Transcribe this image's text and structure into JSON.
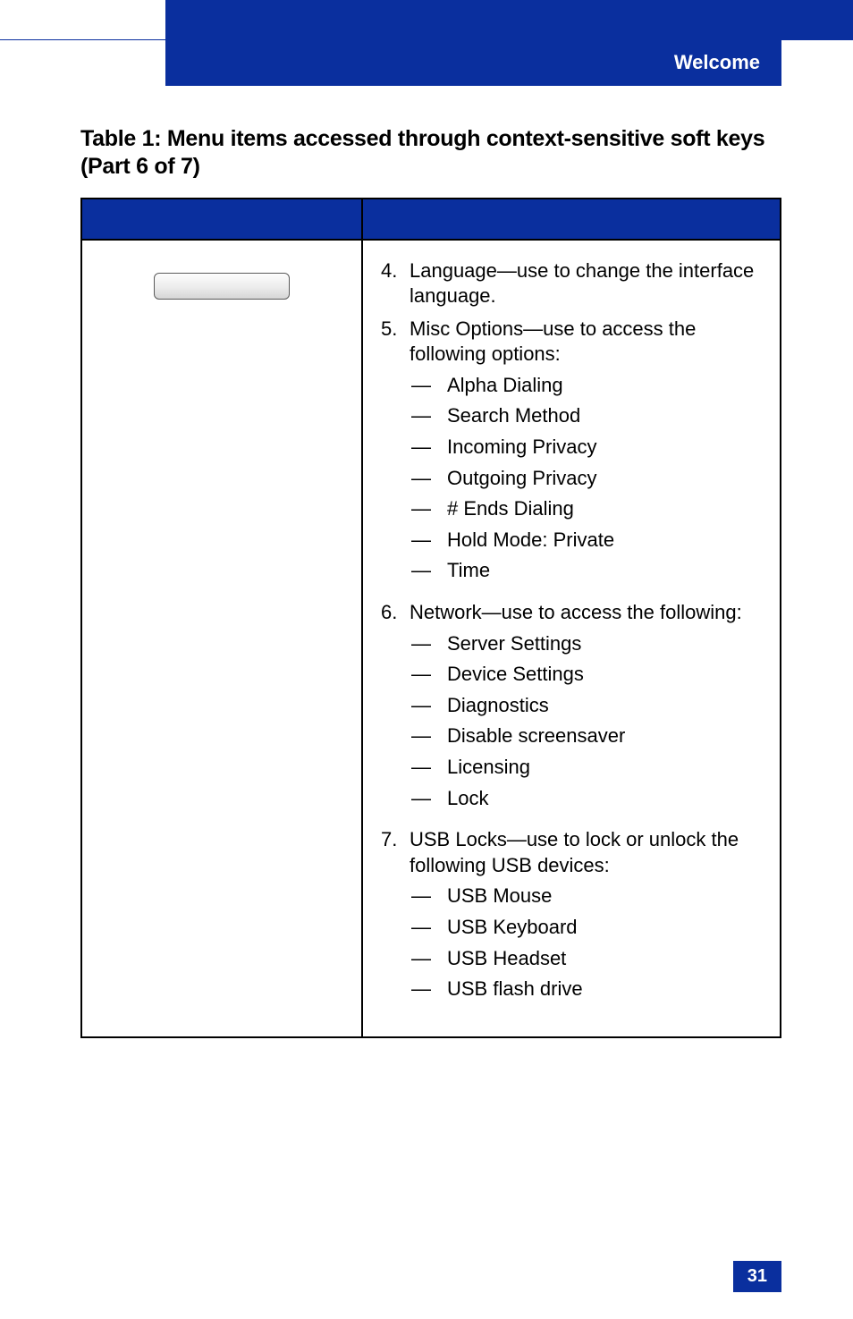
{
  "header": {
    "section_label": "Welcome"
  },
  "table": {
    "title": "Table 1: Menu items accessed through context-sensitive soft keys (Part 6 of 7)",
    "items": [
      {
        "num": "4.",
        "text": "Language—use to change the interface language."
      },
      {
        "num": "5.",
        "text": "Misc Options—use to access the following options:",
        "sub": [
          "Alpha Dialing",
          "Search Method",
          "Incoming Privacy",
          "Outgoing Privacy",
          "# Ends Dialing",
          "Hold Mode: Private",
          "Time"
        ]
      },
      {
        "num": "6.",
        "text": "Network—use to access the following:",
        "sub": [
          "Server Settings",
          "Device Settings",
          "Diagnostics",
          " Disable screensaver",
          "Licensing",
          "Lock"
        ]
      },
      {
        "num": "7.",
        "text": "USB Locks—use to lock or unlock the following USB devices:",
        "sub": [
          "USB Mouse",
          "USB Keyboard",
          "USB Headset",
          " USB flash drive"
        ]
      }
    ]
  },
  "footer": {
    "page_number": "31"
  }
}
